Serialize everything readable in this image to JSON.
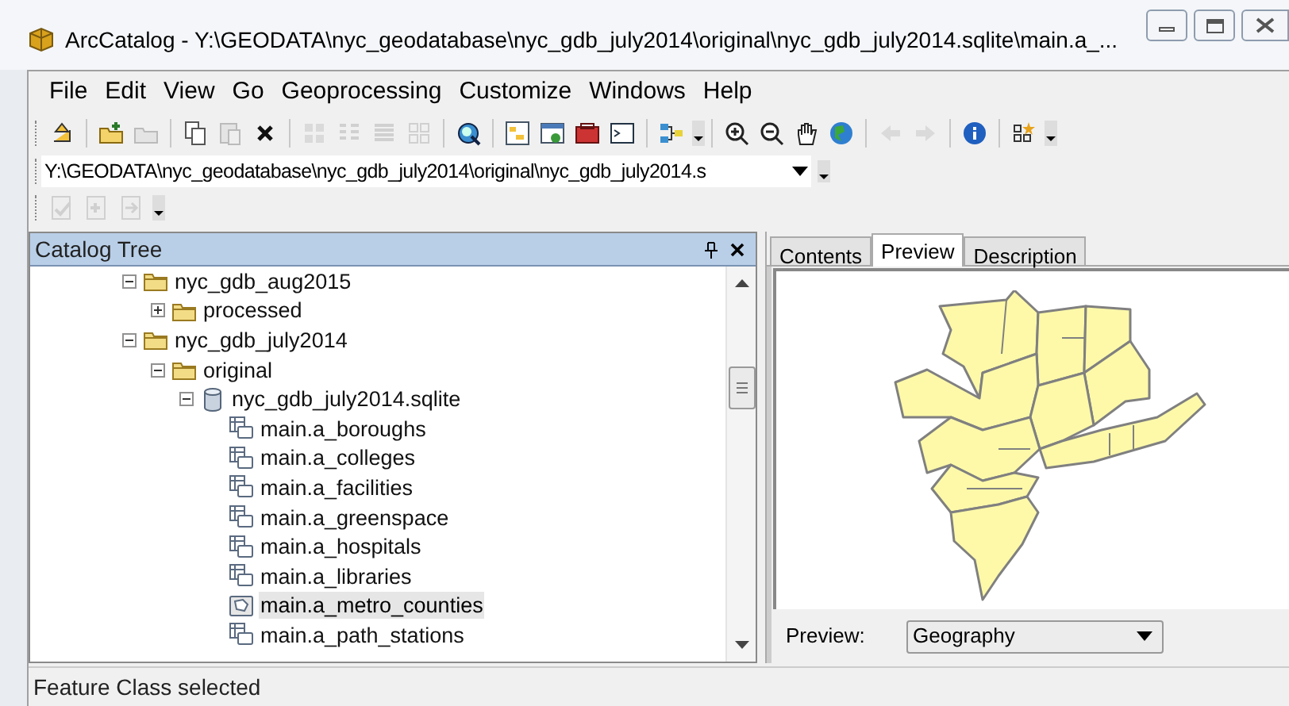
{
  "window": {
    "title": "ArcCatalog - Y:\\GEODATA\\nyc_geodatabase\\nyc_gdb_july2014\\original\\nyc_gdb_july2014.sqlite\\main.a_..."
  },
  "menu": [
    "File",
    "Edit",
    "View",
    "Go",
    "Geoprocessing",
    "Customize",
    "Windows",
    "Help"
  ],
  "toolbar": [
    {
      "kind": "up",
      "disabled": false
    },
    {
      "kind": "sep"
    },
    {
      "kind": "connect",
      "disabled": false
    },
    {
      "kind": "disconnect",
      "disabled": true
    },
    {
      "kind": "sep"
    },
    {
      "kind": "copy",
      "disabled": false
    },
    {
      "kind": "paste",
      "disabled": true
    },
    {
      "kind": "delete",
      "disabled": false
    },
    {
      "kind": "sep"
    },
    {
      "kind": "largeicons",
      "disabled": true
    },
    {
      "kind": "list",
      "disabled": true
    },
    {
      "kind": "details",
      "disabled": true
    },
    {
      "kind": "thumbs",
      "disabled": true
    },
    {
      "kind": "sep"
    },
    {
      "kind": "search",
      "disabled": false
    },
    {
      "kind": "sep"
    },
    {
      "kind": "catalog",
      "disabled": false
    },
    {
      "kind": "window",
      "disabled": false
    },
    {
      "kind": "toolbox",
      "disabled": false
    },
    {
      "kind": "console",
      "disabled": false
    },
    {
      "kind": "sep"
    },
    {
      "kind": "model",
      "disabled": false
    },
    {
      "kind": "more"
    },
    {
      "kind": "sep"
    },
    {
      "kind": "zoomin",
      "disabled": false
    },
    {
      "kind": "zoomout",
      "disabled": false
    },
    {
      "kind": "pan",
      "disabled": false
    },
    {
      "kind": "globe",
      "disabled": false
    },
    {
      "kind": "sep"
    },
    {
      "kind": "back",
      "disabled": true
    },
    {
      "kind": "forward",
      "disabled": true
    },
    {
      "kind": "sep"
    },
    {
      "kind": "info",
      "disabled": false
    },
    {
      "kind": "sep"
    },
    {
      "kind": "metadata",
      "disabled": false
    },
    {
      "kind": "more"
    }
  ],
  "location": {
    "value": "Y:\\GEODATA\\nyc_geodatabase\\nyc_gdb_july2014\\original\\nyc_gdb_july2014.s"
  },
  "metadata_toolbar": [
    {
      "kind": "validate",
      "disabled": true
    },
    {
      "kind": "import",
      "disabled": true
    },
    {
      "kind": "export",
      "disabled": true
    },
    {
      "kind": "more"
    }
  ],
  "catalog_tree": {
    "title": "Catalog Tree",
    "items": [
      {
        "label": "nyc_gdb_aug2015",
        "kind": "folder",
        "expanded": true,
        "selected": false,
        "children": [
          {
            "label": "processed",
            "kind": "folder",
            "expanded": false,
            "selected": false
          }
        ]
      },
      {
        "label": "nyc_gdb_july2014",
        "kind": "folder",
        "expanded": true,
        "selected": false,
        "children": [
          {
            "label": "original",
            "kind": "folder",
            "expanded": true,
            "selected": false,
            "children": [
              {
                "label": "nyc_gdb_july2014.sqlite",
                "kind": "database",
                "expanded": true,
                "selected": false,
                "children": [
                  {
                    "label": "main.a_boroughs",
                    "kind": "table",
                    "selected": false
                  },
                  {
                    "label": "main.a_colleges",
                    "kind": "table",
                    "selected": false
                  },
                  {
                    "label": "main.a_facilities",
                    "kind": "table",
                    "selected": false
                  },
                  {
                    "label": "main.a_greenspace",
                    "kind": "table",
                    "selected": false
                  },
                  {
                    "label": "main.a_hospitals",
                    "kind": "table",
                    "selected": false
                  },
                  {
                    "label": "main.a_libraries",
                    "kind": "table",
                    "selected": false
                  },
                  {
                    "label": "main.a_metro_counties",
                    "kind": "polygon",
                    "selected": true
                  },
                  {
                    "label": "main.a_path_stations",
                    "kind": "table",
                    "selected": false
                  }
                ]
              }
            ]
          }
        ]
      }
    ]
  },
  "tabs": [
    {
      "label": "Contents",
      "selected": false
    },
    {
      "label": "Preview",
      "selected": true
    },
    {
      "label": "Description",
      "selected": false
    }
  ],
  "preview": {
    "label": "Preview:",
    "value": "Geography"
  },
  "status_bar": "Feature Class selected"
}
